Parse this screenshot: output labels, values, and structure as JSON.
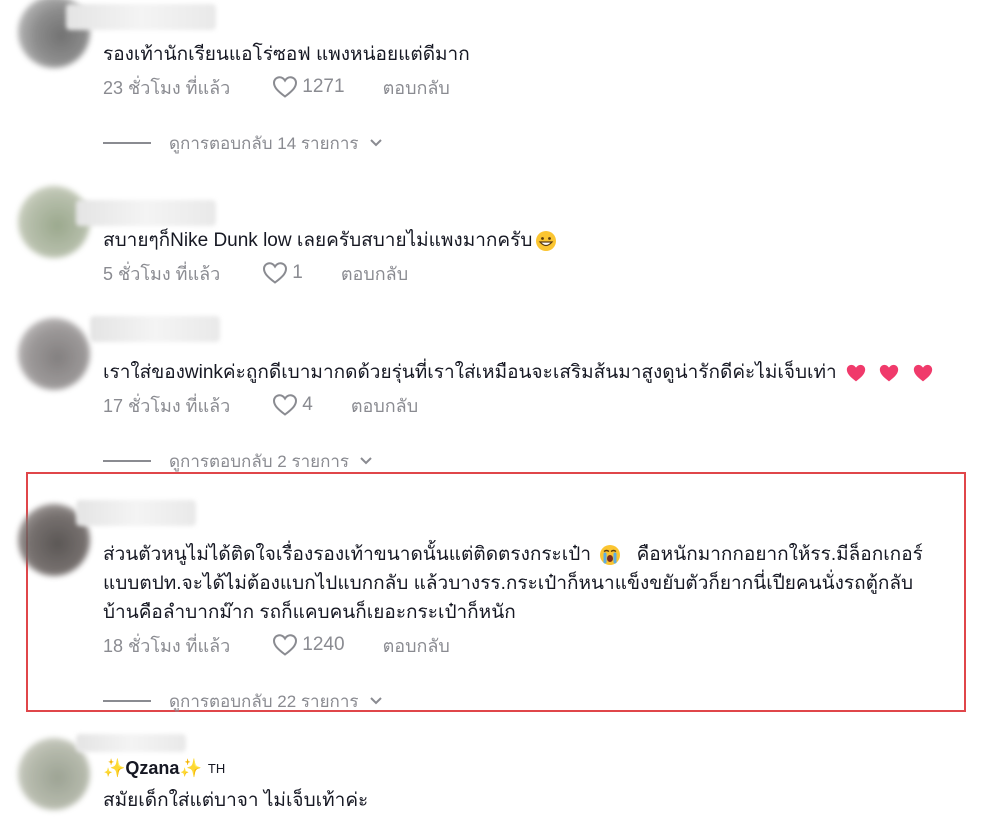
{
  "comments": [
    {
      "text": "รองเท้านักเรียนแอโร่ซอฟ แพงหน่อยแต่ดีมาก",
      "time": "23 ชั่วโมง ที่แล้ว",
      "likes": "1271",
      "reply_label": "ตอบกลับ",
      "view_replies": "ดูการตอบกลับ 14 รายการ"
    },
    {
      "text": "สบายๆก็Nike Dunk low เลยครับสบายไม่แพงมากครับ",
      "time": "5 ชั่วโมง ที่แล้ว",
      "likes": "1",
      "reply_label": "ตอบกลับ"
    },
    {
      "text": "เราใส่ของwinkค่ะถูกดีเบามากดด้วยรุ่นที่เราใส่เหมือนจะเสริมส้นมาสูงดูน่ารักดีค่ะไม่เจ็บเท่า",
      "time": "17 ชั่วโมง ที่แล้ว",
      "likes": "4",
      "reply_label": "ตอบกลับ",
      "view_replies": "ดูการตอบกลับ 2 รายการ"
    },
    {
      "text_lines": [
        "ส่วนตัวหนูไม่ได้ติดใจเรื่องรองเท้าขนาดนั้นแต่ติดตรงกระเป๋า",
        "คือหนักมากกอยากให้รร.มีล็อกเกอร์",
        "แบบตปท.จะได้ไม่ต้องแบกไปแบกกลับ แล้วบางรร.กระเป๋าก็หนาแข็งขยับตัวก็ยากนี่เปียคนนั่งรถตู้กลับ",
        "บ้านคือลำบากม๊าก รถก็แคบคนก็เยอะกระเป๋าก็หนัก"
      ],
      "time": "18 ชั่วโมง ที่แล้ว",
      "likes": "1240",
      "reply_label": "ตอบกลับ",
      "view_replies": "ดูการตอบกลับ 22 รายการ"
    },
    {
      "username": "Qzana",
      "badge": "TH",
      "text": "สมัยเด็กใส่แต่บาจา ไม่เจ็บเท้าค่ะ"
    }
  ],
  "icons": {
    "heart": "heart-icon",
    "chevron": "chevron-down-icon",
    "grin": "grinning-face-emoji",
    "heart_emoji": "pink-heart-emoji",
    "crying": "loudly-crying-face-emoji",
    "sparkle": "sparkles-emoji"
  },
  "colors": {
    "text": "#161823",
    "muted": "#8a8b91",
    "highlight": "#e0464a",
    "heart_emoji": "#f03a6b"
  }
}
